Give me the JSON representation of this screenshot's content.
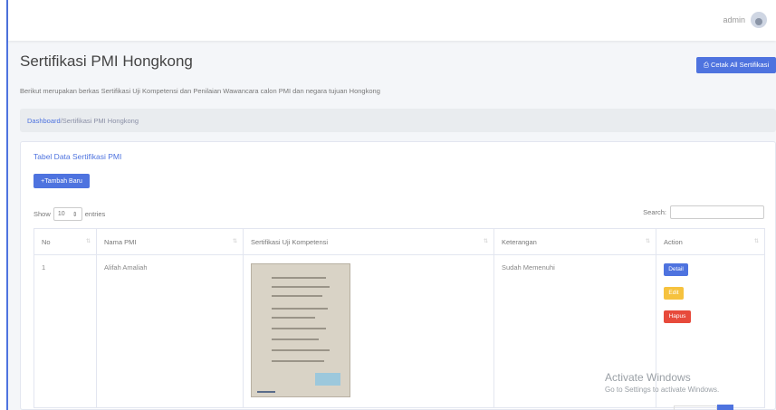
{
  "topbar": {
    "username": "admin"
  },
  "page": {
    "title": "Sertifikasi PMI Hongkong",
    "cetak_button": "⎙ Cetak All Sertifikasi",
    "description": "Berikut merupakan berkas Sertifikasi Uji Kompetensi dan Penilaian Wawancara calon PMI dan negara tujuan Hongkong"
  },
  "breadcrumb": {
    "link": "Dashboard",
    "separator": " /",
    "current": "Sertifikasi PMI Hongkong"
  },
  "card": {
    "title": "Tabel Data Sertifikasi PMI",
    "add_button": "+Tambah Baru",
    "show_label": "Show",
    "entries_value": "10",
    "entries_label": "entries",
    "search_label": "Search:",
    "search_value": ""
  },
  "table": {
    "headers": [
      "No",
      "Nama PMI",
      "Sertifikasi Uji Kompetensi",
      "Keterangan",
      "Action"
    ],
    "rows": [
      {
        "no": "1",
        "nama": "Alifah Amaliah",
        "keterangan": "Sudah Memenuhi",
        "actions": [
          "Detail",
          "Edit",
          "Hapus"
        ]
      }
    ]
  },
  "watermark": {
    "title": "Activate Windows",
    "subtitle": "Go to Settings to activate Windows."
  },
  "colors": {
    "primary": "#4e73df",
    "warning": "#f6c23e",
    "danger": "#e74a3b"
  }
}
